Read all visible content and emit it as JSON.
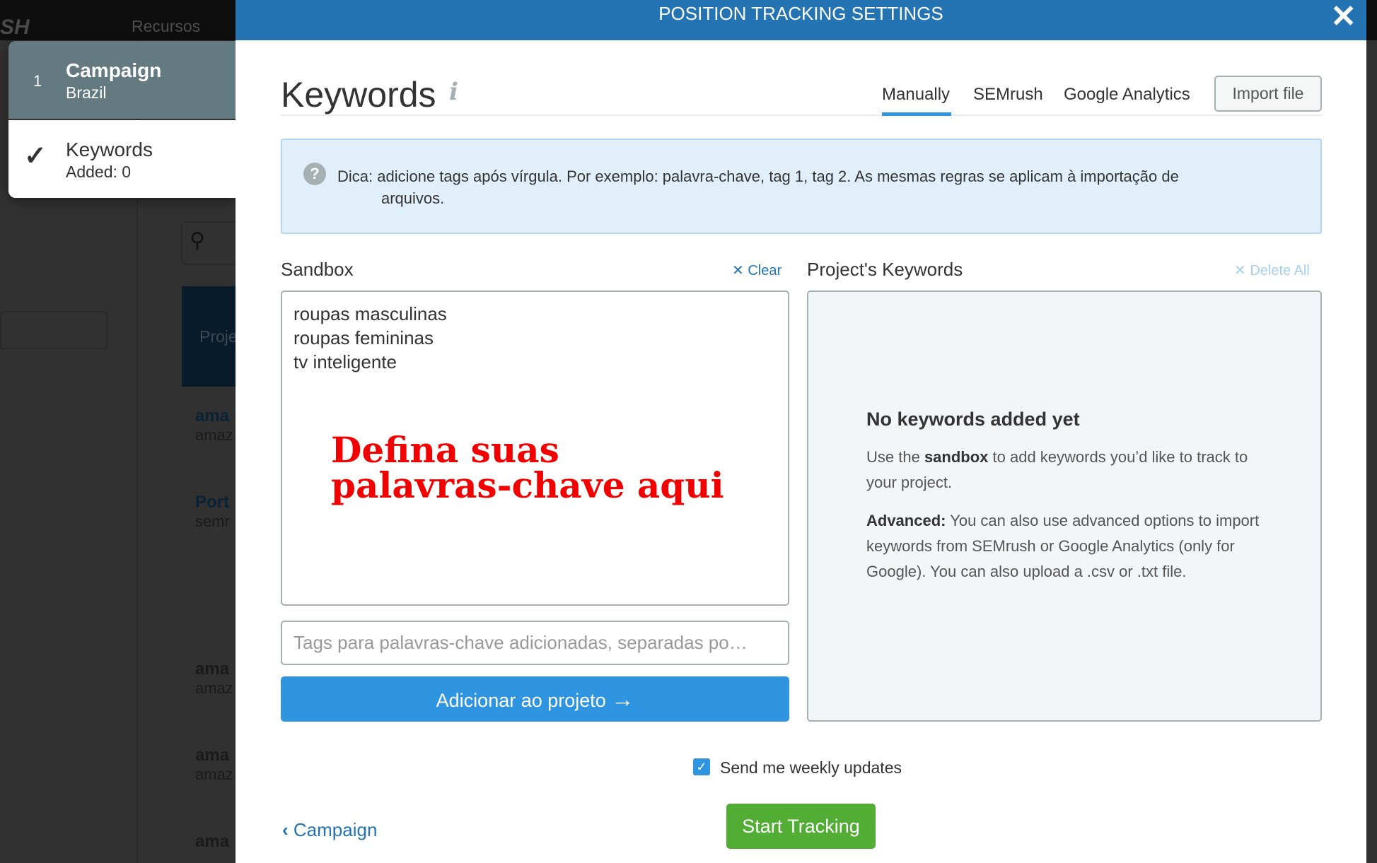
{
  "background": {
    "logo": "SH",
    "nav_item": "Recursos",
    "rows": [
      {
        "title": "ama",
        "sub": "amaz"
      },
      {
        "title": "Port",
        "sub": "semr"
      },
      {
        "title": "ama",
        "sub": "amaz"
      },
      {
        "title": "ama",
        "sub": "amaz"
      },
      {
        "title": "ama",
        "sub": ""
      }
    ],
    "table_header": "Proje"
  },
  "steps": [
    {
      "number": "1",
      "title": "Campaign",
      "subtitle": "Brazil"
    },
    {
      "icon": "check-icon",
      "title": "Keywords",
      "subtitle": "Added: 0"
    }
  ],
  "modal": {
    "title": "POSITION TRACKING SETTINGS",
    "heading": "Keywords",
    "tabs": [
      {
        "label": "Manually",
        "active": true
      },
      {
        "label": "SEMrush",
        "active": false
      },
      {
        "label": "Google Analytics",
        "active": false
      }
    ],
    "import_label": "Import file",
    "tip_line1": "Dica:  adicione tags após vírgula. Por exemplo: palavra-chave, tag 1, tag 2. As mesmas regras se aplicam à importação de",
    "tip_line2": "arquivos.",
    "sandbox_label": "Sandbox",
    "clear_label": "Clear",
    "sandbox_value": "roupas masculinas\nroupas femininas\ntv inteligente",
    "annotation_line1": "Defina suas",
    "annotation_line2": "palavras-chave aqui",
    "tags_placeholder": "Tags para palavras-chave adicionadas, separadas po…",
    "add_label": "Adicionar ao projeto",
    "project_label": "Project's Keywords",
    "delete_all_label": "Delete All",
    "empty_heading": "No keywords added yet",
    "empty_p1_a": "Use the ",
    "empty_p1_b": "sandbox",
    "empty_p1_c": " to add keywords you’d like to track to your project.",
    "empty_p2_a": "Advanced:",
    "empty_p2_b": " You can also use advanced options to import keywords from SEMrush or Google Analytics (only for Google). You can also upload a .csv or .txt file.",
    "weekly_label": "Send me weekly updates",
    "weekly_checked": true,
    "back_label": "Campaign",
    "start_label": "Start Tracking"
  },
  "colors": {
    "header": "#2474b4",
    "primary": "#2f95e0",
    "success": "#51ad33",
    "annotation": "#f20000"
  }
}
